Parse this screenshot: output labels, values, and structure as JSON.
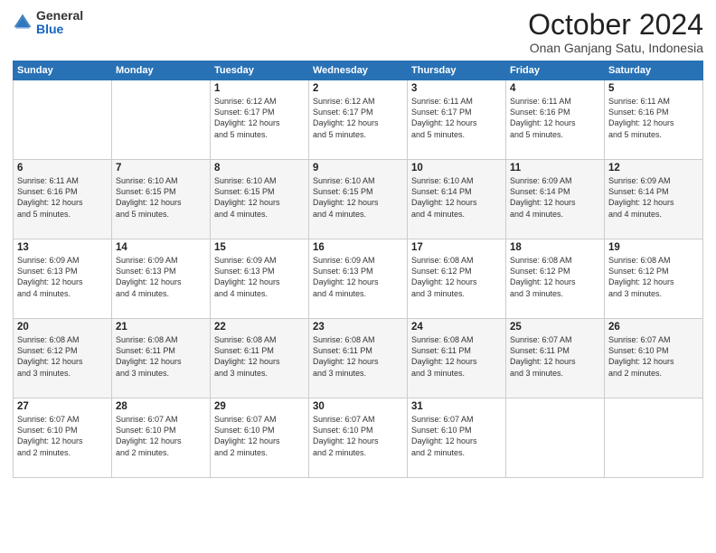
{
  "logo": {
    "general": "General",
    "blue": "Blue"
  },
  "header": {
    "month": "October 2024",
    "location": "Onan Ganjang Satu, Indonesia"
  },
  "weekdays": [
    "Sunday",
    "Monday",
    "Tuesday",
    "Wednesday",
    "Thursday",
    "Friday",
    "Saturday"
  ],
  "weeks": [
    [
      {
        "day": "",
        "info": ""
      },
      {
        "day": "",
        "info": ""
      },
      {
        "day": "1",
        "info": "Sunrise: 6:12 AM\nSunset: 6:17 PM\nDaylight: 12 hours\nand 5 minutes."
      },
      {
        "day": "2",
        "info": "Sunrise: 6:12 AM\nSunset: 6:17 PM\nDaylight: 12 hours\nand 5 minutes."
      },
      {
        "day": "3",
        "info": "Sunrise: 6:11 AM\nSunset: 6:17 PM\nDaylight: 12 hours\nand 5 minutes."
      },
      {
        "day": "4",
        "info": "Sunrise: 6:11 AM\nSunset: 6:16 PM\nDaylight: 12 hours\nand 5 minutes."
      },
      {
        "day": "5",
        "info": "Sunrise: 6:11 AM\nSunset: 6:16 PM\nDaylight: 12 hours\nand 5 minutes."
      }
    ],
    [
      {
        "day": "6",
        "info": "Sunrise: 6:11 AM\nSunset: 6:16 PM\nDaylight: 12 hours\nand 5 minutes."
      },
      {
        "day": "7",
        "info": "Sunrise: 6:10 AM\nSunset: 6:15 PM\nDaylight: 12 hours\nand 5 minutes."
      },
      {
        "day": "8",
        "info": "Sunrise: 6:10 AM\nSunset: 6:15 PM\nDaylight: 12 hours\nand 4 minutes."
      },
      {
        "day": "9",
        "info": "Sunrise: 6:10 AM\nSunset: 6:15 PM\nDaylight: 12 hours\nand 4 minutes."
      },
      {
        "day": "10",
        "info": "Sunrise: 6:10 AM\nSunset: 6:14 PM\nDaylight: 12 hours\nand 4 minutes."
      },
      {
        "day": "11",
        "info": "Sunrise: 6:09 AM\nSunset: 6:14 PM\nDaylight: 12 hours\nand 4 minutes."
      },
      {
        "day": "12",
        "info": "Sunrise: 6:09 AM\nSunset: 6:14 PM\nDaylight: 12 hours\nand 4 minutes."
      }
    ],
    [
      {
        "day": "13",
        "info": "Sunrise: 6:09 AM\nSunset: 6:13 PM\nDaylight: 12 hours\nand 4 minutes."
      },
      {
        "day": "14",
        "info": "Sunrise: 6:09 AM\nSunset: 6:13 PM\nDaylight: 12 hours\nand 4 minutes."
      },
      {
        "day": "15",
        "info": "Sunrise: 6:09 AM\nSunset: 6:13 PM\nDaylight: 12 hours\nand 4 minutes."
      },
      {
        "day": "16",
        "info": "Sunrise: 6:09 AM\nSunset: 6:13 PM\nDaylight: 12 hours\nand 4 minutes."
      },
      {
        "day": "17",
        "info": "Sunrise: 6:08 AM\nSunset: 6:12 PM\nDaylight: 12 hours\nand 3 minutes."
      },
      {
        "day": "18",
        "info": "Sunrise: 6:08 AM\nSunset: 6:12 PM\nDaylight: 12 hours\nand 3 minutes."
      },
      {
        "day": "19",
        "info": "Sunrise: 6:08 AM\nSunset: 6:12 PM\nDaylight: 12 hours\nand 3 minutes."
      }
    ],
    [
      {
        "day": "20",
        "info": "Sunrise: 6:08 AM\nSunset: 6:12 PM\nDaylight: 12 hours\nand 3 minutes."
      },
      {
        "day": "21",
        "info": "Sunrise: 6:08 AM\nSunset: 6:11 PM\nDaylight: 12 hours\nand 3 minutes."
      },
      {
        "day": "22",
        "info": "Sunrise: 6:08 AM\nSunset: 6:11 PM\nDaylight: 12 hours\nand 3 minutes."
      },
      {
        "day": "23",
        "info": "Sunrise: 6:08 AM\nSunset: 6:11 PM\nDaylight: 12 hours\nand 3 minutes."
      },
      {
        "day": "24",
        "info": "Sunrise: 6:08 AM\nSunset: 6:11 PM\nDaylight: 12 hours\nand 3 minutes."
      },
      {
        "day": "25",
        "info": "Sunrise: 6:07 AM\nSunset: 6:11 PM\nDaylight: 12 hours\nand 3 minutes."
      },
      {
        "day": "26",
        "info": "Sunrise: 6:07 AM\nSunset: 6:10 PM\nDaylight: 12 hours\nand 2 minutes."
      }
    ],
    [
      {
        "day": "27",
        "info": "Sunrise: 6:07 AM\nSunset: 6:10 PM\nDaylight: 12 hours\nand 2 minutes."
      },
      {
        "day": "28",
        "info": "Sunrise: 6:07 AM\nSunset: 6:10 PM\nDaylight: 12 hours\nand 2 minutes."
      },
      {
        "day": "29",
        "info": "Sunrise: 6:07 AM\nSunset: 6:10 PM\nDaylight: 12 hours\nand 2 minutes."
      },
      {
        "day": "30",
        "info": "Sunrise: 6:07 AM\nSunset: 6:10 PM\nDaylight: 12 hours\nand 2 minutes."
      },
      {
        "day": "31",
        "info": "Sunrise: 6:07 AM\nSunset: 6:10 PM\nDaylight: 12 hours\nand 2 minutes."
      },
      {
        "day": "",
        "info": ""
      },
      {
        "day": "",
        "info": ""
      }
    ]
  ]
}
